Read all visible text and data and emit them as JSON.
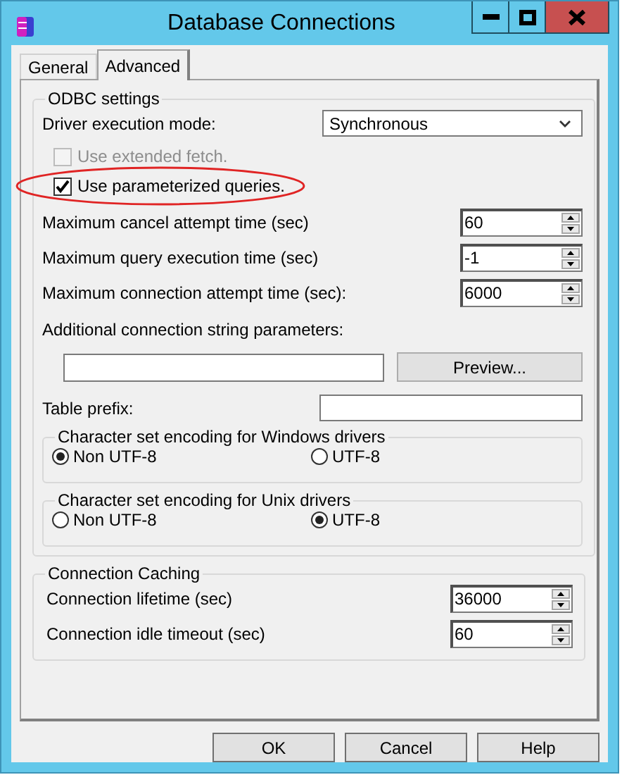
{
  "window": {
    "title": "Database Connections"
  },
  "tabs": [
    {
      "label": "General",
      "selected": false
    },
    {
      "label": "Advanced",
      "selected": true
    }
  ],
  "odbc": {
    "title": "ODBC settings",
    "execution_mode": {
      "label": "Driver execution mode:",
      "value": "Synchronous"
    },
    "checkboxes": [
      {
        "label": "Use extended fetch.",
        "checked": false,
        "disabled": true,
        "highlighted": false
      },
      {
        "label": "Use parameterized queries.",
        "checked": true,
        "disabled": false,
        "highlighted": true
      }
    ],
    "spinners": [
      {
        "label": "Maximum cancel attempt time (sec)",
        "value": "60"
      },
      {
        "label": "Maximum query execution time (sec)",
        "value": "-1"
      },
      {
        "label": "Maximum connection attempt time (sec):",
        "value": "6000"
      }
    ],
    "connection_string": {
      "label": "Additional connection string parameters:",
      "button": "Preview..."
    },
    "table_prefix": {
      "label": "Table prefix:"
    },
    "encodings": [
      {
        "title": "Character set encoding for Windows drivers",
        "options": [
          {
            "label": "Non UTF-8",
            "selected": true
          },
          {
            "label": "UTF-8",
            "selected": false
          }
        ]
      },
      {
        "title": "Character set encoding for Unix drivers",
        "options": [
          {
            "label": "Non UTF-8",
            "selected": false
          },
          {
            "label": "UTF-8",
            "selected": true
          }
        ]
      }
    ]
  },
  "caching": {
    "title": "Connection Caching",
    "spinners": [
      {
        "label": "Connection lifetime (sec)",
        "value": "36000"
      },
      {
        "label": "Connection idle timeout (sec)",
        "value": "60"
      }
    ]
  },
  "buttons": [
    "OK",
    "Cancel",
    "Help"
  ]
}
